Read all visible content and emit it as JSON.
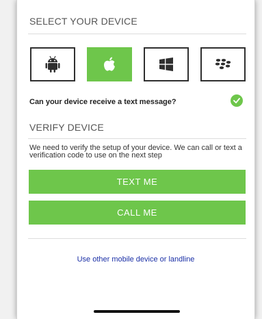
{
  "select_device": {
    "title": "SELECT YOUR DEVICE",
    "devices": [
      {
        "icon": "android-icon",
        "selected": false
      },
      {
        "icon": "apple-icon",
        "selected": true
      },
      {
        "icon": "windows-icon",
        "selected": false
      },
      {
        "icon": "blackberry-icon",
        "selected": false
      }
    ],
    "question": "Can your device receive a text message?"
  },
  "verify": {
    "title": "VERIFY DEVICE",
    "description": "We need to verify the setup of your device. We can call or text a verification code to use on the next step",
    "text_button": "TEXT ME",
    "call_button": "CALL ME"
  },
  "other_device_link": "Use other mobile device or landline",
  "colors": {
    "accent": "#6ec64b",
    "link": "#1a2fa6",
    "border": "#2f2f2f"
  }
}
